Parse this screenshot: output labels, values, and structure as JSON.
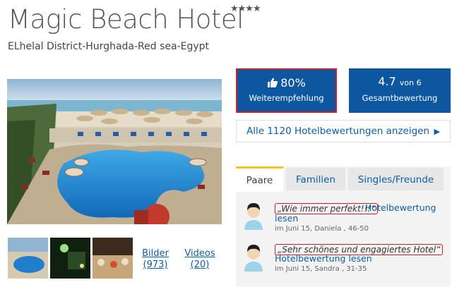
{
  "hotel": {
    "name": "Magic Beach Hotel",
    "stars": "★★★★",
    "location": "ELhelal District-Hurghada-Red sea-Egypt"
  },
  "stats": {
    "recommendation_value": "80%",
    "recommendation_label": "Weiterempfehlung",
    "rating_value": "4.7",
    "rating_of": "von 6",
    "rating_label": "Gesamtbewertung"
  },
  "all_reviews_link": "Alle 1120 Hotelbewertungen anzeigen",
  "media": {
    "pictures_label": "Bilder",
    "pictures_count": "(973)",
    "videos_label": "Videos",
    "videos_count": "(20)"
  },
  "tabs": [
    {
      "label": "Paare",
      "active": true
    },
    {
      "label": "Familien",
      "active": false
    },
    {
      "label": "Singles/Freunde",
      "active": false
    }
  ],
  "reviews": [
    {
      "quote": "„Wie immer perfekt!!!“",
      "link_a": "Hotelbewertung",
      "link_b": "lesen",
      "meta": "im Juni 15, Daniela , 46-50"
    },
    {
      "quote": "„Sehr schönes und engagiertes Hotel“",
      "link_b": "Hotelbewertung lesen",
      "meta": "im Juni 15, Sandra , 31-35"
    }
  ],
  "colors": {
    "primary_blue": "#0d57a0",
    "link_blue": "#0b5fa5",
    "highlight_red": "#d21d2c",
    "tab_accent": "#f3c319"
  },
  "icons": {
    "recommend": "thumbs-up-icon",
    "more": "arrow-right-icon",
    "avatar": "user-avatar-icon"
  }
}
